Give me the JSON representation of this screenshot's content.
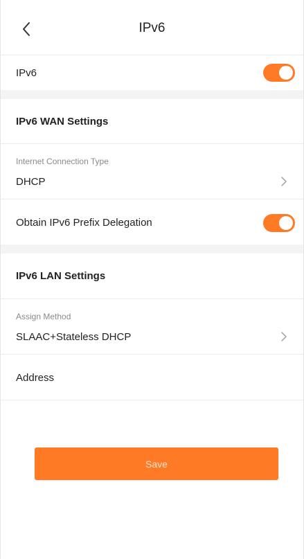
{
  "header": {
    "title": "IPv6"
  },
  "ipv6_toggle": {
    "label": "IPv6",
    "enabled": true
  },
  "wan": {
    "section_title": "IPv6 WAN Settings",
    "connection_type_label": "Internet Connection Type",
    "connection_type_value": "DHCP",
    "prefix_delegation_label": "Obtain IPv6 Prefix Delegation",
    "prefix_delegation_enabled": true
  },
  "lan": {
    "section_title": "IPv6 LAN Settings",
    "assign_method_label": "Assign Method",
    "assign_method_value": "SLAAC+Stateless DHCP",
    "address_label": "Address"
  },
  "save_label": "Save",
  "colors": {
    "accent": "#ff7a25",
    "divider": "#ececec",
    "section_gap": "#f4f4f4"
  },
  "icons": {
    "back": "chevron-left-icon",
    "next": "chevron-right-icon"
  }
}
